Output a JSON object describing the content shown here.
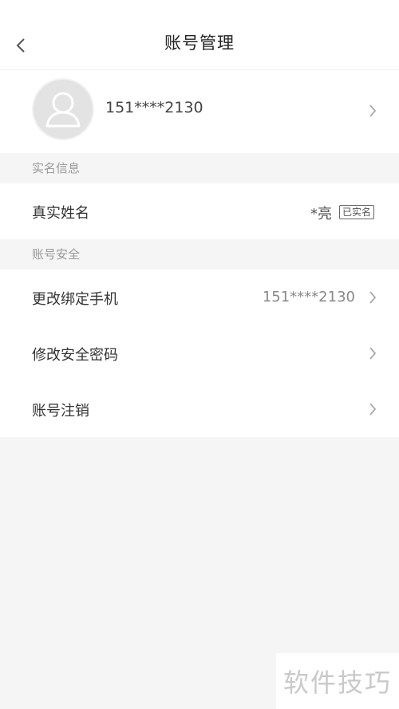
{
  "header": {
    "title": "账号管理"
  },
  "profile": {
    "phone": "151****2130"
  },
  "sections": {
    "realname": {
      "label": "实名信息",
      "row_label": "真实姓名",
      "name_value": "*亮",
      "badge": "已实名"
    },
    "security": {
      "label": "账号安全",
      "rows": [
        {
          "label": "更改绑定手机",
          "value": "151****2130"
        },
        {
          "label": "修改安全密码"
        },
        {
          "label": "账号注销"
        }
      ]
    }
  },
  "watermark": {
    "text": "软件技巧"
  }
}
